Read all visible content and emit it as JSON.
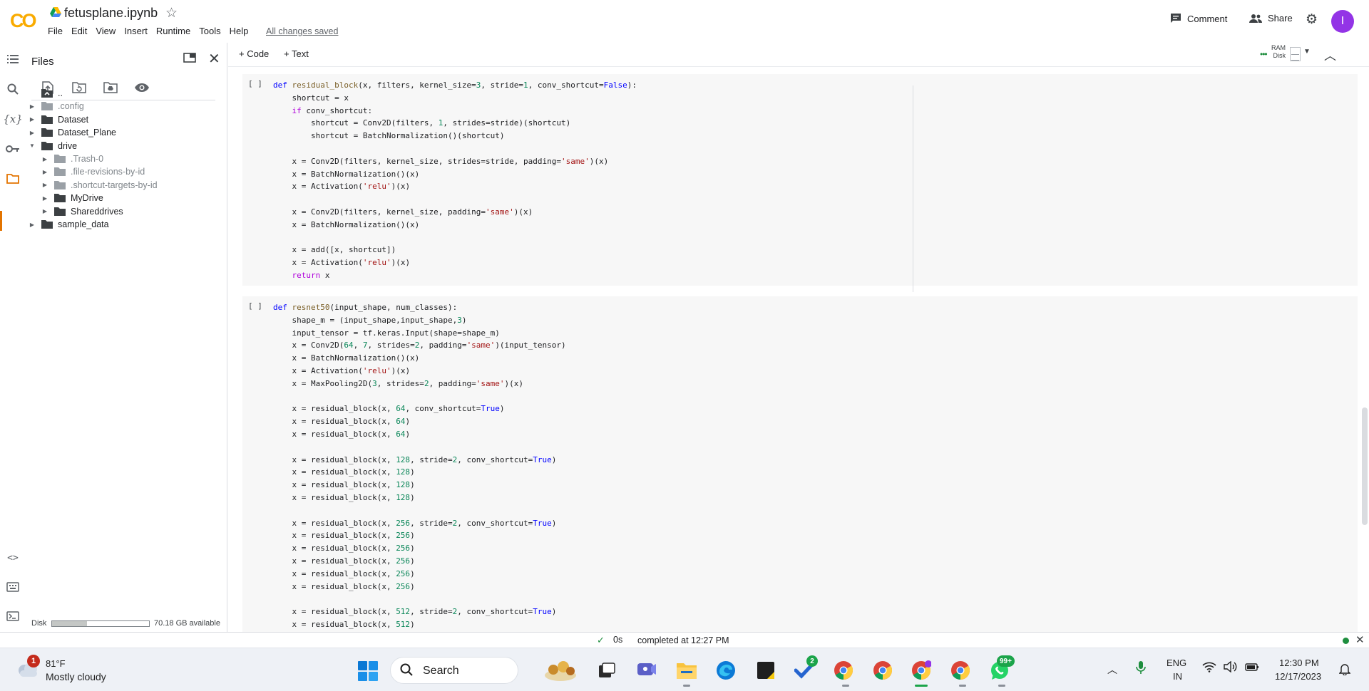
{
  "header": {
    "logo": "CO",
    "title": "fetusplane.ipynb",
    "menu": [
      "File",
      "Edit",
      "View",
      "Insert",
      "Runtime",
      "Tools",
      "Help"
    ],
    "save_status": "All changes saved",
    "comment_label": "Comment",
    "share_label": "Share",
    "avatar_letter": "I"
  },
  "files_panel": {
    "title": "Files",
    "tree": [
      {
        "name": "..",
        "indent": 0,
        "caret": false,
        "dim": false,
        "type": "up"
      },
      {
        "name": ".config",
        "indent": 0,
        "caret": true,
        "dim": true,
        "type": "folder"
      },
      {
        "name": "Dataset",
        "indent": 0,
        "caret": true,
        "dim": false,
        "type": "folder"
      },
      {
        "name": "Dataset_Plane",
        "indent": 0,
        "caret": true,
        "dim": false,
        "type": "folder"
      },
      {
        "name": "drive",
        "indent": 0,
        "caret": "open",
        "dim": false,
        "type": "folder"
      },
      {
        "name": ".Trash-0",
        "indent": 1,
        "caret": true,
        "dim": true,
        "type": "folder"
      },
      {
        "name": ".file-revisions-by-id",
        "indent": 1,
        "caret": true,
        "dim": true,
        "type": "folder"
      },
      {
        "name": ".shortcut-targets-by-id",
        "indent": 1,
        "caret": true,
        "dim": true,
        "type": "folder"
      },
      {
        "name": "MyDrive",
        "indent": 1,
        "caret": true,
        "dim": false,
        "type": "folder"
      },
      {
        "name": "Shareddrives",
        "indent": 1,
        "caret": true,
        "dim": false,
        "type": "folder"
      },
      {
        "name": "sample_data",
        "indent": 0,
        "caret": true,
        "dim": false,
        "type": "folder"
      }
    ],
    "disk_label": "Disk",
    "disk_used_fraction": 0.36,
    "disk_available": "70.18 GB available"
  },
  "toolbar": {
    "add_code": "+ Code",
    "add_text": "+ Text",
    "ram_label": "RAM",
    "disk_label": "Disk"
  },
  "cells": [
    {
      "run_mark": "[ ]",
      "lines": [
        [
          [
            "kw",
            "def "
          ],
          [
            "fn",
            "residual_block"
          ],
          [
            "",
            "(x, filters, kernel_size="
          ],
          [
            "num",
            "3"
          ],
          [
            "",
            ", stride="
          ],
          [
            "num",
            "1"
          ],
          [
            "",
            ", conv_shortcut="
          ],
          [
            "bool",
            "False"
          ],
          [
            "",
            "):"
          ]
        ],
        [
          [
            "",
            "    shortcut = x"
          ]
        ],
        [
          [
            "kwp",
            "    if "
          ],
          [
            "",
            "conv_shortcut:"
          ]
        ],
        [
          [
            "",
            "        shortcut = Conv2D(filters, "
          ],
          [
            "num",
            "1"
          ],
          [
            "",
            ", strides=stride)(shortcut)"
          ]
        ],
        [
          [
            "",
            "        shortcut = BatchNormalization()(shortcut)"
          ]
        ],
        [
          [
            "",
            ""
          ]
        ],
        [
          [
            "",
            "    x = Conv2D(filters, kernel_size, strides=stride, padding="
          ],
          [
            "str",
            "'same'"
          ],
          [
            "",
            ")(x)"
          ]
        ],
        [
          [
            "",
            "    x = BatchNormalization()(x)"
          ]
        ],
        [
          [
            "",
            "    x = Activation("
          ],
          [
            "str",
            "'relu'"
          ],
          [
            "",
            ")(x)"
          ]
        ],
        [
          [
            "",
            ""
          ]
        ],
        [
          [
            "",
            "    x = Conv2D(filters, kernel_size, padding="
          ],
          [
            "str",
            "'same'"
          ],
          [
            "",
            ")(x)"
          ]
        ],
        [
          [
            "",
            "    x = BatchNormalization()(x)"
          ]
        ],
        [
          [
            "",
            ""
          ]
        ],
        [
          [
            "",
            "    x = add([x, shortcut])"
          ]
        ],
        [
          [
            "",
            "    x = Activation("
          ],
          [
            "str",
            "'relu'"
          ],
          [
            "",
            ")(x)"
          ]
        ],
        [
          [
            "kwp",
            "    return "
          ],
          [
            "",
            "x"
          ]
        ]
      ]
    },
    {
      "run_mark": "[ ]",
      "lines": [
        [
          [
            "kw",
            "def "
          ],
          [
            "fn",
            "resnet50"
          ],
          [
            "",
            "(input_shape, num_classes):"
          ]
        ],
        [
          [
            "",
            "    shape_m = (input_shape,input_shape,"
          ],
          [
            "num",
            "3"
          ],
          [
            "",
            ")"
          ]
        ],
        [
          [
            "",
            "    input_tensor = tf.keras.Input(shape=shape_m)"
          ]
        ],
        [
          [
            "",
            "    x = Conv2D("
          ],
          [
            "num",
            "64"
          ],
          [
            "",
            ", "
          ],
          [
            "num",
            "7"
          ],
          [
            "",
            ", strides="
          ],
          [
            "num",
            "2"
          ],
          [
            "",
            ", padding="
          ],
          [
            "str",
            "'same'"
          ],
          [
            "",
            ")(input_tensor)"
          ]
        ],
        [
          [
            "",
            "    x = BatchNormalization()(x)"
          ]
        ],
        [
          [
            "",
            "    x = Activation("
          ],
          [
            "str",
            "'relu'"
          ],
          [
            "",
            ")(x)"
          ]
        ],
        [
          [
            "",
            "    x = MaxPooling2D("
          ],
          [
            "num",
            "3"
          ],
          [
            "",
            ", strides="
          ],
          [
            "num",
            "2"
          ],
          [
            "",
            ", padding="
          ],
          [
            "str",
            "'same'"
          ],
          [
            "",
            ")(x)"
          ]
        ],
        [
          [
            "",
            ""
          ]
        ],
        [
          [
            "",
            "    x = residual_block(x, "
          ],
          [
            "num",
            "64"
          ],
          [
            "",
            ", conv_shortcut="
          ],
          [
            "bool",
            "True"
          ],
          [
            "",
            ")"
          ]
        ],
        [
          [
            "",
            "    x = residual_block(x, "
          ],
          [
            "num",
            "64"
          ],
          [
            "",
            ")"
          ]
        ],
        [
          [
            "",
            "    x = residual_block(x, "
          ],
          [
            "num",
            "64"
          ],
          [
            "",
            ")"
          ]
        ],
        [
          [
            "",
            ""
          ]
        ],
        [
          [
            "",
            "    x = residual_block(x, "
          ],
          [
            "num",
            "128"
          ],
          [
            "",
            ", stride="
          ],
          [
            "num",
            "2"
          ],
          [
            "",
            ", conv_shortcut="
          ],
          [
            "bool",
            "True"
          ],
          [
            "",
            ")"
          ]
        ],
        [
          [
            "",
            "    x = residual_block(x, "
          ],
          [
            "num",
            "128"
          ],
          [
            "",
            ")"
          ]
        ],
        [
          [
            "",
            "    x = residual_block(x, "
          ],
          [
            "num",
            "128"
          ],
          [
            "",
            ")"
          ]
        ],
        [
          [
            "",
            "    x = residual_block(x, "
          ],
          [
            "num",
            "128"
          ],
          [
            "",
            ")"
          ]
        ],
        [
          [
            "",
            ""
          ]
        ],
        [
          [
            "",
            "    x = residual_block(x, "
          ],
          [
            "num",
            "256"
          ],
          [
            "",
            ", stride="
          ],
          [
            "num",
            "2"
          ],
          [
            "",
            ", conv_shortcut="
          ],
          [
            "bool",
            "True"
          ],
          [
            "",
            ")"
          ]
        ],
        [
          [
            "",
            "    x = residual_block(x, "
          ],
          [
            "num",
            "256"
          ],
          [
            "",
            ")"
          ]
        ],
        [
          [
            "",
            "    x = residual_block(x, "
          ],
          [
            "num",
            "256"
          ],
          [
            "",
            ")"
          ]
        ],
        [
          [
            "",
            "    x = residual_block(x, "
          ],
          [
            "num",
            "256"
          ],
          [
            "",
            ")"
          ]
        ],
        [
          [
            "",
            "    x = residual_block(x, "
          ],
          [
            "num",
            "256"
          ],
          [
            "",
            ")"
          ]
        ],
        [
          [
            "",
            "    x = residual_block(x, "
          ],
          [
            "num",
            "256"
          ],
          [
            "",
            ")"
          ]
        ],
        [
          [
            "",
            ""
          ]
        ],
        [
          [
            "",
            "    x = residual_block(x, "
          ],
          [
            "num",
            "512"
          ],
          [
            "",
            ", stride="
          ],
          [
            "num",
            "2"
          ],
          [
            "",
            ", conv_shortcut="
          ],
          [
            "bool",
            "True"
          ],
          [
            "",
            ")"
          ]
        ],
        [
          [
            "",
            "    x = residual_block(x, "
          ],
          [
            "num",
            "512"
          ],
          [
            "",
            ")"
          ]
        ]
      ]
    }
  ],
  "statusbar": {
    "duration": "0s",
    "message": "completed at 12:27 PM"
  },
  "taskbar": {
    "weather_badge": "1",
    "weather_temp": "81°F",
    "weather_desc": "Mostly cloudy",
    "search_label": "Search",
    "todo_badge": "2",
    "whatsapp_badge": "99+",
    "lang_line1": "ENG",
    "lang_line2": "IN",
    "time": "12:30 PM",
    "date": "12/17/2023"
  },
  "colors": {
    "colab_orange": "#f9ab00",
    "accent_orange": "#e37400",
    "cell_bg": "#f7f7f7",
    "avatar": "#9334e6",
    "status_green": "#1e8e3e"
  },
  "icons": {
    "rail": [
      "table-of-contents-icon",
      "search-icon",
      "variables-icon",
      "key-icon",
      "folder-icon",
      "code-snippets-icon",
      "command-palette-icon",
      "terminal-icon"
    ],
    "files_toolbar": [
      "upload-icon",
      "refresh-icon",
      "mount-drive-icon",
      "hidden-files-icon"
    ]
  }
}
